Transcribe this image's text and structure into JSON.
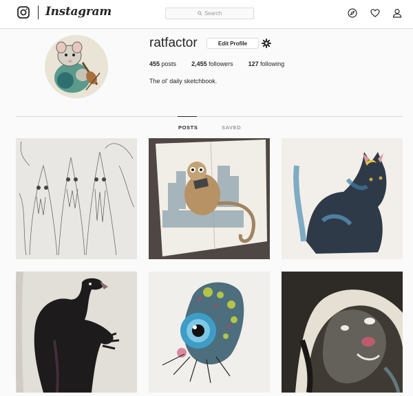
{
  "topbar": {
    "brand": "Instagram",
    "search_placeholder": "Search",
    "icons": [
      "instagram-logo-icon",
      "search-icon",
      "explore-compass-icon",
      "heart-icon",
      "profile-icon"
    ]
  },
  "profile": {
    "username": "ratfactor",
    "edit_label": "Edit Profile",
    "posts_count": "455",
    "posts_label": "posts",
    "followers_count": "2,455",
    "followers_label": "followers",
    "following_count": "127",
    "following_label": "following",
    "bio": "The ol' daily sketchbook."
  },
  "tabs": [
    {
      "label": "POSTS",
      "active": true
    },
    {
      "label": "SAVED",
      "active": false
    }
  ],
  "posts": [
    {
      "subject": "pencil sketch of three hooded creatures"
    },
    {
      "subject": "watercolor lemur on a sketchbook page"
    },
    {
      "subject": "watercolor black cat with crescent moon"
    },
    {
      "subject": "ink vulture creature"
    },
    {
      "subject": "watercolor bug-eyed creature"
    },
    {
      "subject": "dark watercolor creature face"
    }
  ]
}
